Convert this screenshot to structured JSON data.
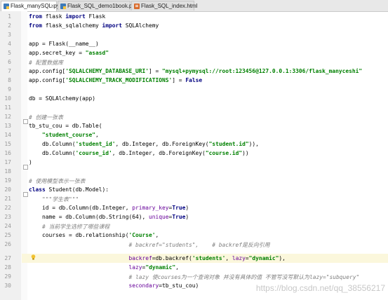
{
  "tabs": [
    {
      "label": "Flask_manySQL.py",
      "active": true,
      "icon": "python-file-icon"
    },
    {
      "label": "Flask_SQL_demo1book.py",
      "active": false,
      "icon": "python-file-icon"
    },
    {
      "label": "Flask_SQL_index.html",
      "active": false,
      "icon": "html-file-icon"
    }
  ],
  "close_glyph": "×",
  "line_numbers": [
    "1",
    "2",
    "3",
    "4",
    "5",
    "6",
    "7",
    "8",
    "9",
    "10",
    "11",
    "12",
    "13",
    "14",
    "15",
    "16",
    "17",
    "18",
    "19",
    "20",
    "21",
    "22",
    "23",
    "24",
    "25",
    "26",
    "27",
    "28",
    "29",
    "30"
  ],
  "lines": {
    "l1": {
      "kw1": "from",
      "t1": " flask ",
      "kw2": "import",
      "t2": " Flask"
    },
    "l2": {
      "kw1": "from",
      "t1": " flask_sqlalchemy ",
      "kw2": "import",
      "t2": " SQLAlchemy"
    },
    "l4": {
      "t1": "app = Flask(__name__)"
    },
    "l5": {
      "t1": "app.secret_key = ",
      "s1": "\"asasd\""
    },
    "l6": {
      "c1": "# 配置数据库"
    },
    "l7": {
      "t1": "app.config[",
      "s1": "'SQLALCHEMY_DATABASE_URI'",
      "t2": "] = ",
      "s2": "\"mysql+pymysql://root:123456@127.0.0.1:3306/flask_manyceshi\""
    },
    "l8": {
      "t1": "app.config[",
      "s1": "'SQLALCHEMY_TRACK_MODIFICATIONS'",
      "t2": "] = ",
      "kw1": "False"
    },
    "l10": {
      "t1": "db = SQLAlchemy(app)"
    },
    "l12": {
      "c1": "# 创建一张表"
    },
    "l13": {
      "t1": "tb_stu_cou = db.Table("
    },
    "l14": {
      "t0": "    ",
      "s1": "\"student_course\"",
      "t1": ","
    },
    "l15": {
      "t0": "    db.Column(",
      "s1": "'student_id'",
      "t1": ", db.Integer, db.ForeignKey(",
      "s2": "\"student.id\"",
      "t2": ")),"
    },
    "l16": {
      "t0": "    db.Column(",
      "s1": "'course_id'",
      "t1": ", db.Integer, db.ForeignKey(",
      "s2": "\"course.id\"",
      "t2": "))"
    },
    "l17": {
      "t1": ")"
    },
    "l19": {
      "c1": "# 使用模型表示一张表"
    },
    "l20": {
      "kw1": "class",
      "t1": " Student(db.Model):"
    },
    "l21": {
      "t0": "    ",
      "c1": "\"\"\"学生表\"\"\""
    },
    "l22": {
      "t0": "    id = db.Column(db.Integer, ",
      "k1": "primary_key",
      "t1": "=",
      "kw1": "True",
      "t2": ")"
    },
    "l23": {
      "t0": "    name = db.Column(db.String(64), ",
      "k1": "unique",
      "t1": "=",
      "kw1": "True",
      "t2": ")"
    },
    "l24": {
      "t0": "    ",
      "c1": "# 当前学生选修了哪些课程"
    },
    "l25": {
      "t0": "    courses = db.relationship(",
      "s1": "'Course'",
      "t1": ","
    },
    "l26": {
      "t0": "                              ",
      "c1": "# backref=\"students\",    # backref是反向引用"
    },
    "l27": {
      "t0": "                              ",
      "k1": "backref",
      "t1": "=db.backref(",
      "s1": "'students'",
      "t2": ", ",
      "k2": "lazy",
      "t3": "=",
      "s2": "\"dynamic\"",
      "t4": "),"
    },
    "l28": {
      "t0": "                              ",
      "k1": "lazy",
      "t1": "=",
      "s1": "\"dynamic\"",
      "t2": ","
    },
    "l29": {
      "t0": "                              ",
      "c1": "# lazy 使courses为一个查询对象 并没有具体的值 不管写没写默认为lazy=\"subquery\""
    },
    "l30": {
      "t0": "                              ",
      "k1": "secondary",
      "t1": "=tb_stu_cou)"
    }
  },
  "watermark": "https://blog.csdn.net/qq_38556217",
  "colors": {
    "keyword": "#000080",
    "string": "#008000",
    "comment": "#808080",
    "kwarg": "#660099",
    "highlight_line": "#fbf7dc"
  }
}
